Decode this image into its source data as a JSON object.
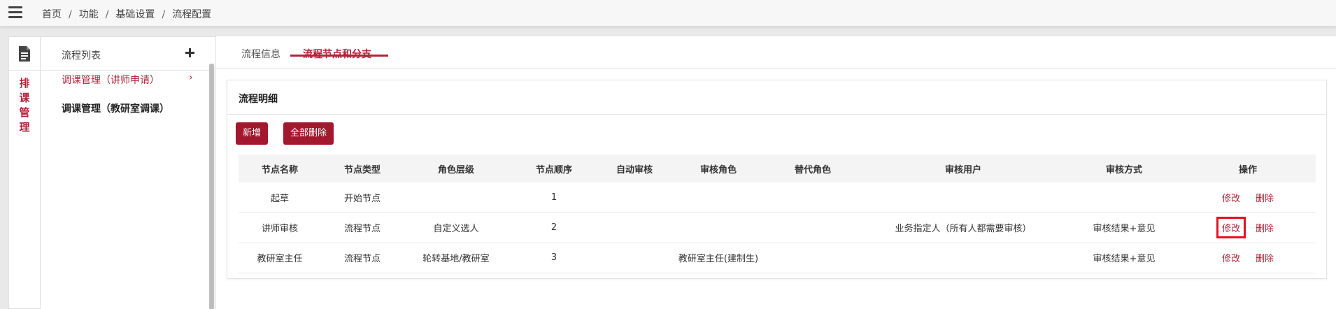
{
  "header": {
    "breadcrumb": [
      "首页",
      "功能",
      "基础设置",
      "流程配置"
    ],
    "separator": "/"
  },
  "rail": {
    "icon": "document-icon",
    "label_chars": [
      "排",
      "课",
      "管",
      "理"
    ]
  },
  "process_list": {
    "title": "流程列表",
    "add_icon": "plus-icon",
    "items": [
      {
        "label": "调课管理（讲师申请）",
        "active": true
      },
      {
        "label": "调课管理（教研室调课）",
        "active": false
      }
    ],
    "chevron": "›"
  },
  "tabs": [
    {
      "label": "流程信息",
      "active": false
    },
    {
      "label": "流程节点和分支",
      "active": true
    }
  ],
  "card": {
    "title": "流程明细",
    "buttons": {
      "add": "新增",
      "delete_all": "全部删除"
    }
  },
  "table": {
    "headers": [
      "节点名称",
      "节点类型",
      "角色层级",
      "节点顺序",
      "自动审核",
      "审核角色",
      "替代角色",
      "审核用户",
      "审核方式",
      "操作"
    ],
    "rows": [
      {
        "name": "起草",
        "type": "开始节点",
        "role_level": "",
        "order": "1",
        "auto": "",
        "review_role": "",
        "alt_role": "",
        "review_user": "",
        "method": "",
        "edit": "修改",
        "delete": "删除"
      },
      {
        "name": "讲师审核",
        "type": "流程节点",
        "role_level": "自定义选人",
        "order": "2",
        "auto": "",
        "review_role": "",
        "alt_role": "",
        "review_user": "业务指定人（所有人都需要审核）",
        "method": "审核结果+意见",
        "edit": "修改",
        "delete": "删除"
      },
      {
        "name": "教研室主任",
        "type": "流程节点",
        "role_level": "轮转基地/教研室",
        "order": "3",
        "auto": "",
        "review_role": "教研室主任(建制生)",
        "alt_role": "",
        "review_user": "",
        "method": "审核结果+意见",
        "edit": "修改",
        "delete": "删除"
      }
    ]
  },
  "colors": {
    "accent": "#b0243a",
    "button": "#a3182e",
    "highlight": "#e3121f"
  }
}
